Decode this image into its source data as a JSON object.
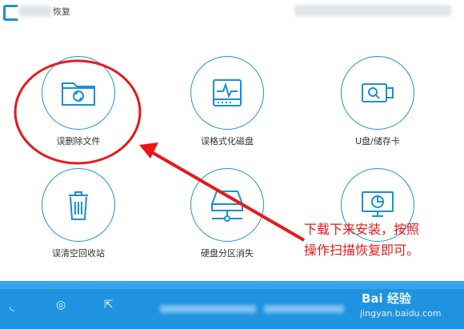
{
  "window": {
    "title": "恢复"
  },
  "items": [
    {
      "label": "误删除文件",
      "icon": "folder-recycle-icon"
    },
    {
      "label": "误格式化磁盘",
      "icon": "hard-disk-pulse-icon"
    },
    {
      "label": "U盘/储存卡",
      "icon": "usb-drive-icon"
    },
    {
      "label": "误清空回收站",
      "icon": "trash-bin-icon"
    },
    {
      "label": "硬盘分区消失",
      "icon": "disk-partition-network-icon"
    },
    {
      "label": "",
      "icon": "monitor-icon"
    }
  ],
  "annotation": {
    "line1": "下载下来安装，按照",
    "line2": "操作扫描恢复即可。",
    "color": "#e8181a"
  },
  "watermark": {
    "brand": "Bai 经验",
    "url": "jingyan.baidu.com"
  },
  "colors": {
    "accent": "#1a8fd8",
    "bottom_bar": "#1f93e0"
  }
}
